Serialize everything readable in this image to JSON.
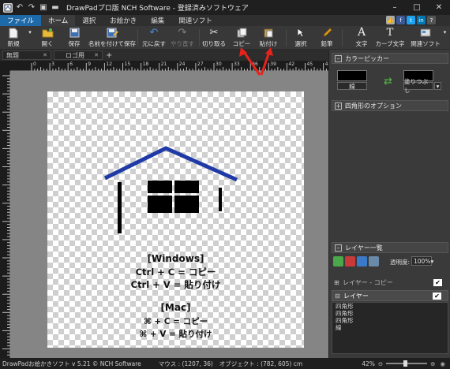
{
  "window": {
    "title": "DrawPadプロ版 NCH Software - 登録済みソフトウェア",
    "quick_icons": [
      "app-icon",
      "undo-icon",
      "redo-icon",
      "save-icon",
      "folder-icon"
    ]
  },
  "menu": {
    "file": "ファイル",
    "items": [
      "ホーム",
      "選択",
      "お絵かき",
      "編集",
      "関連ソフト"
    ]
  },
  "toolbar": {
    "new": "新規",
    "open": "開く",
    "save": "保存",
    "save_as": "名前を付けて保存",
    "undo": "元に戻す",
    "redo": "やり直す",
    "cut": "切り取る",
    "copy": "コピー",
    "paste": "貼付け",
    "select": "選択",
    "pencil": "鉛筆",
    "text": "文字",
    "curve_text": "カーブ文字",
    "related": "関連ソフト"
  },
  "tabs": [
    "無題",
    "ロゴ用"
  ],
  "ruler": {
    "h": [
      "0",
      "3",
      "6",
      "9",
      "12",
      "15",
      "18",
      "21",
      "24",
      "27",
      "30",
      "33",
      "36",
      "39",
      "42",
      "45",
      "48"
    ]
  },
  "canvas": {
    "windows_heading": "[Windows]",
    "win_copy": "Ctrl + C = コピー",
    "win_paste": "Ctrl + V = 貼り付け",
    "mac_heading": "[Mac]",
    "mac_copy": "⌘ + C = コピー",
    "mac_paste": "⌘ + V = 貼り付け",
    "colors": {
      "roof": "#1f3aa6",
      "ink": "#000000",
      "arrow": "#e8231a"
    }
  },
  "panel": {
    "color_picker": "カラーピッカー",
    "stroke_label": "線",
    "fill_label": "塗りつぶし",
    "rect_options": "四角形のオプション",
    "layers_title": "レイヤー一覧",
    "opacity_label": "透明度:",
    "opacity_value": "100%",
    "layers": [
      {
        "name": "レイヤー - コピー",
        "visible": true,
        "selected": false
      },
      {
        "name": "レイヤー",
        "visible": true,
        "selected": true
      }
    ],
    "objects": [
      "四角形",
      "四角形",
      "四角形",
      "線"
    ]
  },
  "status": {
    "version": "DrawPadお絵かきソフト v 5.21 © NCH Software",
    "mouse": "マウス : (1207, 36)",
    "object": "オブジェクト : (782, 605) cm",
    "zoom": "42%"
  }
}
